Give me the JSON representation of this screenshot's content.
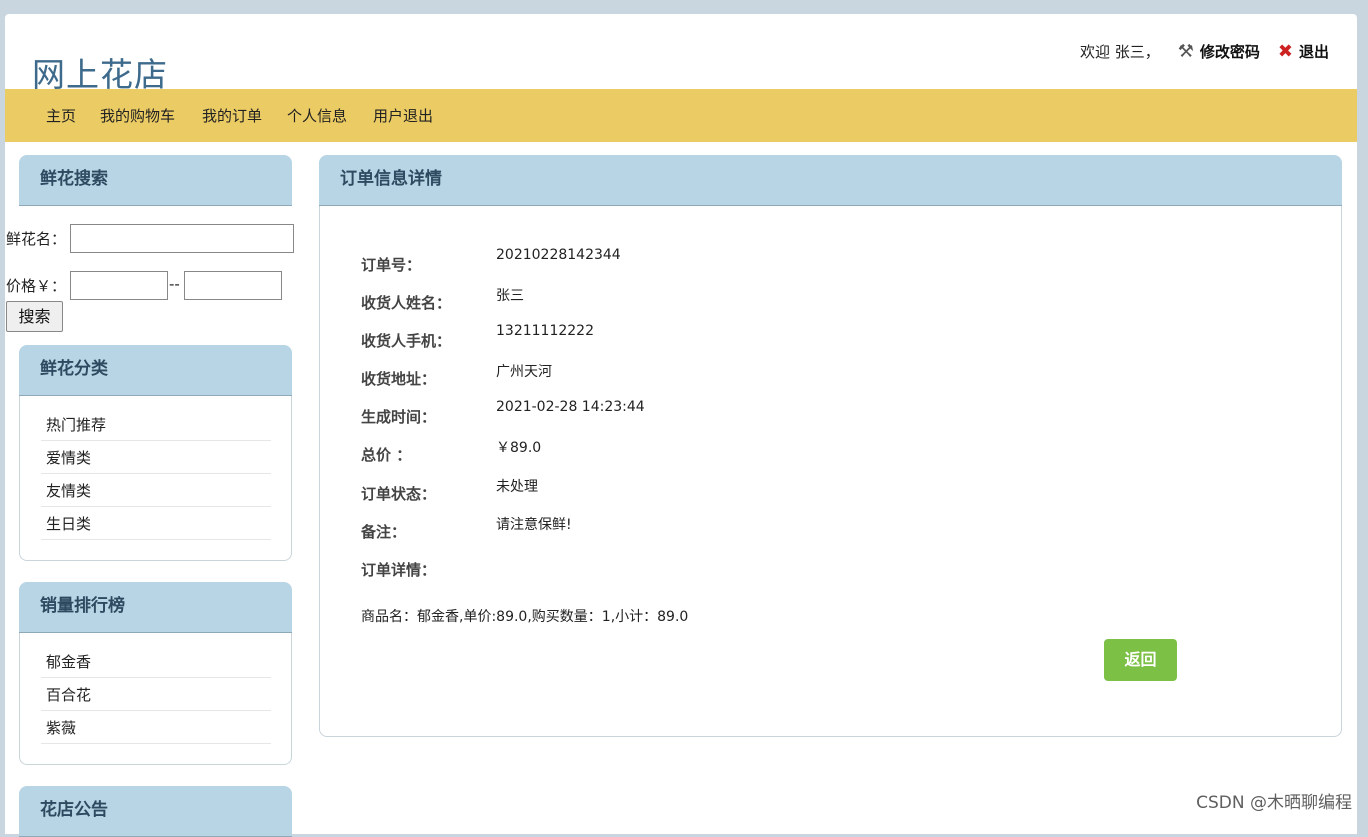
{
  "header": {
    "site_title": "网上花店",
    "welcome": "欢迎 张三，",
    "change_password": "修改密码",
    "logout": "退出",
    "icons": {
      "settings": "wrench-icon",
      "exit": "close-icon"
    }
  },
  "nav": {
    "items": [
      "主页",
      "我的购物车",
      "我的订单",
      "个人信息",
      "用户退出"
    ]
  },
  "search": {
    "title": "鲜花搜索",
    "name_label": "鲜花名：",
    "price_label": "价格￥：",
    "separator": "--",
    "button": "搜索",
    "name_value": "",
    "price_min": "",
    "price_max": ""
  },
  "categories": {
    "title": "鲜花分类",
    "items": [
      "热门推荐",
      "爱情类",
      "友情类",
      "生日类"
    ]
  },
  "ranking": {
    "title": "销量排行榜",
    "items": [
      "郁金香",
      "百合花",
      "紫薇"
    ]
  },
  "notice": {
    "title": "花店公告"
  },
  "order": {
    "title": "订单信息详情",
    "fields": [
      {
        "label": "订单号：",
        "value": "20210228142344"
      },
      {
        "label": "收货人姓名：",
        "value": "张三"
      },
      {
        "label": "收货人手机：",
        "value": "13211112222"
      },
      {
        "label": "收货地址：",
        "value": "广州天河"
      },
      {
        "label": "生成时间：",
        "value": "2021-02-28 14:23:44"
      },
      {
        "label": "总价 ：",
        "value": "￥89.0"
      },
      {
        "label": "订单状态：",
        "value": "未处理"
      },
      {
        "label": "备注：",
        "value": "请注意保鲜!"
      },
      {
        "label": "订单详情：",
        "value": ""
      }
    ],
    "detail_line": "商品名：郁金香,单价:89.0,购买数量：1,小计：89.0",
    "back_button": "返回"
  },
  "watermark": "CSDN @木晒聊编程",
  "colors": {
    "nav_bg": "#ebcb63",
    "box_head": "#b8d5e5",
    "title": "#3e6a8c",
    "back_button": "#7dc046"
  }
}
